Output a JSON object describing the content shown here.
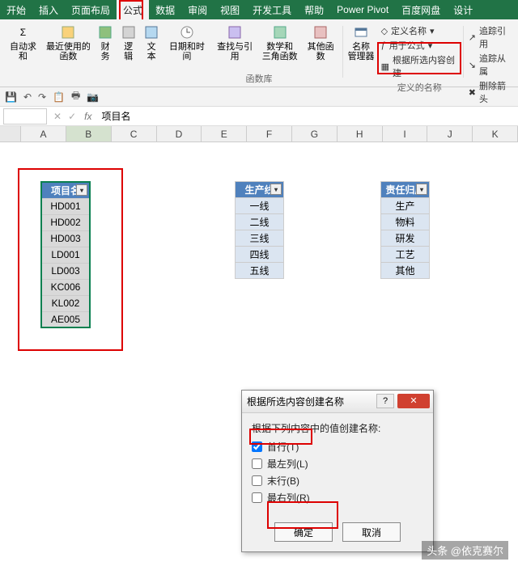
{
  "tabs": [
    "开始",
    "插入",
    "页面布局",
    "公式",
    "数据",
    "审阅",
    "视图",
    "开发工具",
    "帮助",
    "Power Pivot",
    "百度网盘",
    "设计"
  ],
  "active_tab_index": 3,
  "ribbon": {
    "buttons": [
      "自动求和",
      "最近使用的\n函数",
      "财务",
      "逻辑",
      "文本",
      "日期和时间",
      "查找与引用",
      "数学和\n三角函数",
      "其他函数",
      "名称\n管理器"
    ],
    "define_name": "定义名称",
    "use_in_formula": "用于公式",
    "create_from_selection": "根据所选内容创建",
    "defined_names": "定义的名称",
    "lib_label": "函数库",
    "trace_precedents": "追踪引用",
    "trace_dependents": "追踪从属",
    "remove_arrows": "删除箭头"
  },
  "formula_bar": {
    "value": "项目名"
  },
  "columns": [
    "A",
    "B",
    "C",
    "D",
    "E",
    "F",
    "G",
    "H",
    "I",
    "J",
    "K"
  ],
  "selected_col": "B",
  "tables": {
    "t1": {
      "header": "项目名",
      "rows": [
        "HD001",
        "HD002",
        "HD003",
        "LD001",
        "LD003",
        "KC006",
        "KL002",
        "AE005"
      ]
    },
    "t2": {
      "header": "生产线",
      "rows": [
        "一线",
        "二线",
        "三线",
        "四线",
        "五线"
      ]
    },
    "t3": {
      "header": "责任归属",
      "rows": [
        "生产",
        "物料",
        "研发",
        "工艺",
        "其他"
      ]
    }
  },
  "dialog": {
    "title": "根据所选内容创建名称",
    "subtitle": "根据下列内容中的值创建名称:",
    "opts": {
      "top": "首行(T)",
      "left": "最左列(L)",
      "bottom": "末行(B)",
      "right": "最右列(R)"
    },
    "checked": "top",
    "ok": "确定",
    "cancel": "取消"
  },
  "watermark": "头条 @依克赛尔",
  "chart_data": {
    "type": "table",
    "tables": [
      {
        "name": "项目名",
        "values": [
          "HD001",
          "HD002",
          "HD003",
          "LD001",
          "LD003",
          "KC006",
          "KL002",
          "AE005"
        ]
      },
      {
        "name": "生产线",
        "values": [
          "一线",
          "二线",
          "三线",
          "四线",
          "五线"
        ]
      },
      {
        "name": "责任归属",
        "values": [
          "生产",
          "物料",
          "研发",
          "工艺",
          "其他"
        ]
      }
    ]
  }
}
